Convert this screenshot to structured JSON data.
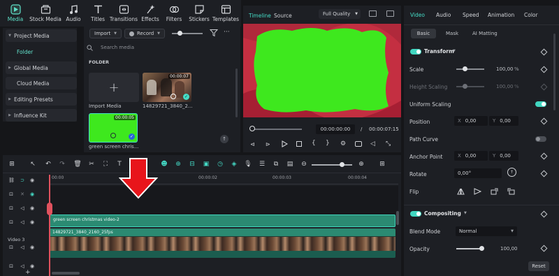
{
  "toolbar": {
    "tools": [
      {
        "label": "Media",
        "icon": "media-icon",
        "active": true
      },
      {
        "label": "Stock Media",
        "icon": "stock-media-icon"
      },
      {
        "label": "Audio",
        "icon": "music-note-icon"
      },
      {
        "label": "Titles",
        "icon": "titles-icon"
      },
      {
        "label": "Transitions",
        "icon": "transitions-icon"
      },
      {
        "label": "Effects",
        "icon": "effects-icon"
      },
      {
        "label": "Filters",
        "icon": "filters-icon"
      },
      {
        "label": "Stickers",
        "icon": "stickers-icon"
      },
      {
        "label": "Templates",
        "icon": "templates-icon"
      }
    ]
  },
  "sidebar": {
    "items": [
      {
        "label": "Project Media"
      },
      {
        "label": "Folder"
      },
      {
        "label": "Global Media"
      },
      {
        "label": "Cloud Media"
      },
      {
        "label": "Editing Presets"
      },
      {
        "label": "Influence Kit"
      }
    ]
  },
  "media": {
    "import_label": "Import",
    "record_label": "Record",
    "search_placeholder": "Search media",
    "folder_heading": "FOLDER",
    "import_media_label": "Import Media",
    "clips": [
      {
        "name": "14829721_3840_2...",
        "duration": "00:00:07"
      },
      {
        "name": "green screen chris...",
        "duration": "00:00:05"
      }
    ]
  },
  "preview": {
    "tab_timeline": "Timeline",
    "tab_source": "Source",
    "quality": "Full Quality",
    "current_time": "00:00:00:00",
    "separator": "/",
    "total_time": "00:00:07:15"
  },
  "inspector": {
    "tabs": [
      "Video",
      "Audio",
      "Speed",
      "Animation",
      "Color"
    ],
    "subtabs": [
      "Basic",
      "Mask",
      "AI Matting"
    ],
    "transform_label": "Transform",
    "scale_label": "Scale",
    "scale_value": "100,00",
    "scale_unit": "%",
    "height_scaling_label": "Height Scaling",
    "height_scaling_value": "100,00",
    "height_scaling_unit": "%",
    "uniform_scaling_label": "Uniform Scaling",
    "position_label": "Position",
    "position_x_label": "X",
    "position_x": "0,00",
    "position_y_label": "Y",
    "position_y": "0,00",
    "path_curve_label": "Path Curve",
    "anchor_point_label": "Anchor Point",
    "anchor_x_label": "X",
    "anchor_x": "0,00",
    "anchor_y_label": "Y",
    "anchor_y": "0,00",
    "rotate_label": "Rotate",
    "rotate_value": "0,00°",
    "flip_label": "Flip",
    "compositing_label": "Compositing",
    "blend_mode_label": "Blend Mode",
    "blend_mode_value": "Normal",
    "opacity_label": "Opacity",
    "opacity_value": "100,00",
    "reset_label": "Reset"
  },
  "timeline": {
    "ruler": [
      "00:00",
      "00:00:02",
      "00:00:03",
      "00:00:04"
    ],
    "clips": [
      {
        "name": "green screen christmas video-2"
      },
      {
        "name": "14829721_3840_2160_25fps"
      }
    ],
    "video3_label": "Video 3"
  },
  "colors": {
    "accent": "#45dcc6",
    "green_screen": "#3ee81e",
    "red_background": "#c42f41",
    "arrow": "#e8151b",
    "clip_teal": "#2b8a72"
  }
}
